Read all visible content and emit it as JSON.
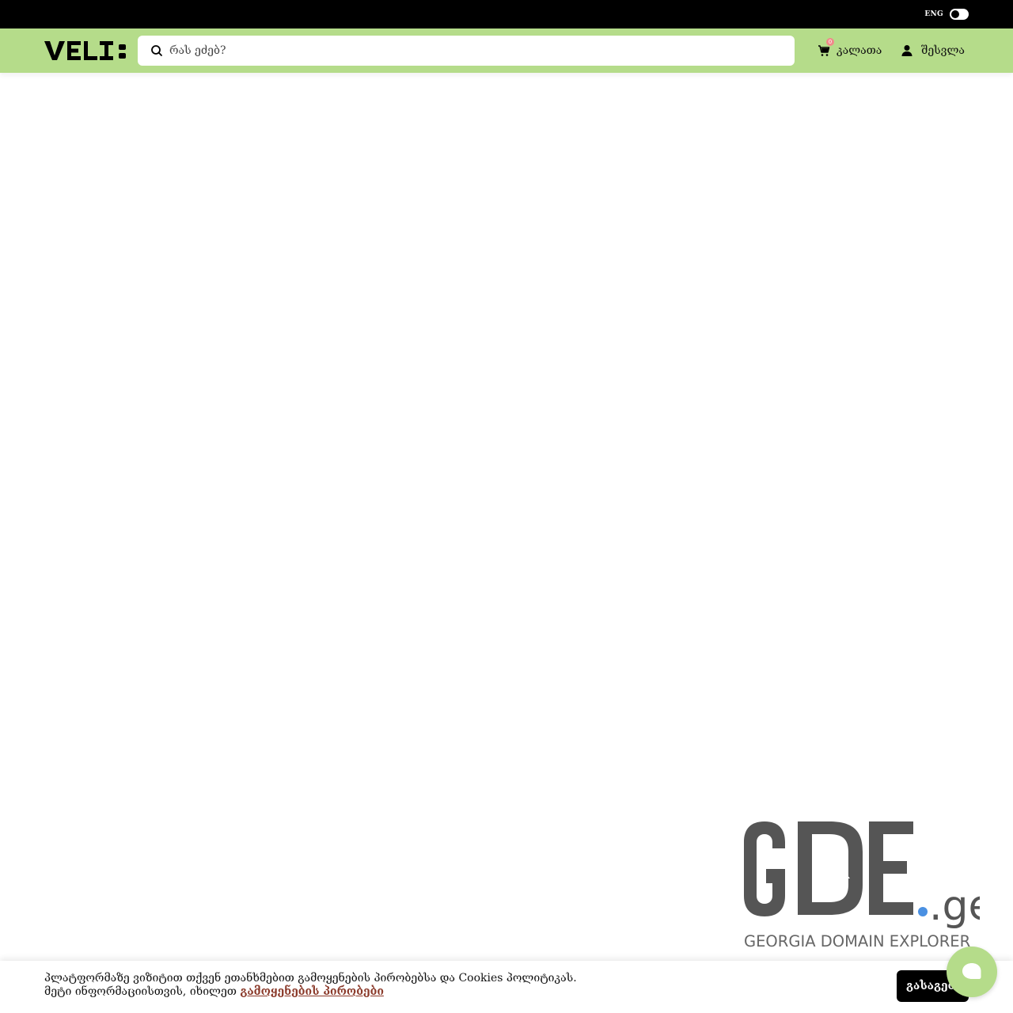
{
  "topbar": {
    "language_label": "ENG"
  },
  "header": {
    "logo_text": "VELI:",
    "search": {
      "placeholder": "რას ეძებ?",
      "value": ""
    },
    "cart": {
      "label": "კალათა",
      "count": "0",
      "icon": "cart-icon"
    },
    "login": {
      "label": "შესვლა",
      "icon": "user-icon"
    }
  },
  "watermark": {
    "brand": "GDE",
    "tld": ".ge",
    "tagline": "GEORGIA DOMAIN EXPLORER"
  },
  "cookie": {
    "text": "პლატფორმაზე ვიზიტით თქვენ ეთანხმებით გამოყენების პირობებსა და Cookies პოლიტიკას. მეტი ინფორმაციისთვის, იხილეთ ",
    "link_label": "გამოყენების პირობები",
    "accept_label": "გასაგებია"
  },
  "colors": {
    "brand_green": "#b5dc8a",
    "topbar": "#000000",
    "cart_badge": "#f08a8a",
    "link": "#8b3a2a",
    "watermark_gray": "#555555",
    "watermark_dot": "#4a90e2"
  }
}
